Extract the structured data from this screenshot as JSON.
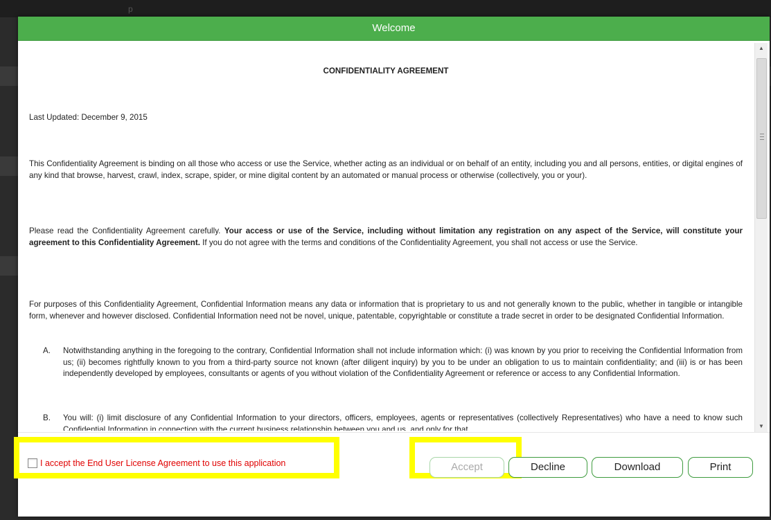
{
  "background": {
    "ghost_text": "p"
  },
  "modal": {
    "title": "Welcome",
    "doc_title": "CONFIDENTIALITY AGREEMENT",
    "last_updated": "Last Updated: December 9, 2015",
    "para1": "This Confidentiality Agreement is binding on all those who access or use the Service, whether acting as an individual or on behalf of an entity, including you and all persons, entities, or digital engines of any kind that browse, harvest, crawl, index, scrape, spider, or mine digital content by an automated or manual process or otherwise (collectively, you or your).",
    "para2_plain": "Please read the Confidentiality Agreement carefully. ",
    "para2_bold": "Your access or use of the Service, including without limitation any registration on any aspect of the Service, will constitute your agreement to this Confidentiality Agreement.",
    "para2_rest": " If you do not agree with the terms and conditions of the Confidentiality Agreement, you shall not access or use the Service.",
    "para3": "For purposes of this Confidentiality Agreement, Confidential Information means any data or information that is proprietary to us and not generally known to the public, whether in tangible or intangible form, whenever and however disclosed. Confidential Information need not be novel, unique, patentable, copyrightable or constitute a trade secret in order to be designated Confidential Information.",
    "list": [
      {
        "letter": "A.",
        "text": "Notwithstanding anything in the foregoing to the contrary, Confidential Information shall not include information which: (i) was known by you prior to receiving the Confidential Information from us; (ii) becomes rightfully known to you from a third-party source not known (after diligent inquiry) by you to be under an obligation to us to maintain confidentiality; and (iii) is or has been independently developed by employees, consultants or agents of you without violation of the Confidentiality Agreement or reference or access to any Confidential Information."
      },
      {
        "letter": "B.",
        "text": "You will: (i) limit disclosure of any Confidential Information to your directors, officers, employees, agents or representatives (collectively Representatives) who have a need to know such Confidential Information in connection with the current business relationship between you and us, and only for that"
      }
    ]
  },
  "footer": {
    "checkbox_label": "I accept the End User License Agreement to use this application",
    "buttons": {
      "accept": "Accept",
      "decline": "Decline",
      "download": "Download",
      "print": "Print"
    }
  },
  "colors": {
    "header": "#4cae4c",
    "highlight": "#ffff00",
    "label_red": "#e00000",
    "button_border": "#3d9b3d"
  }
}
